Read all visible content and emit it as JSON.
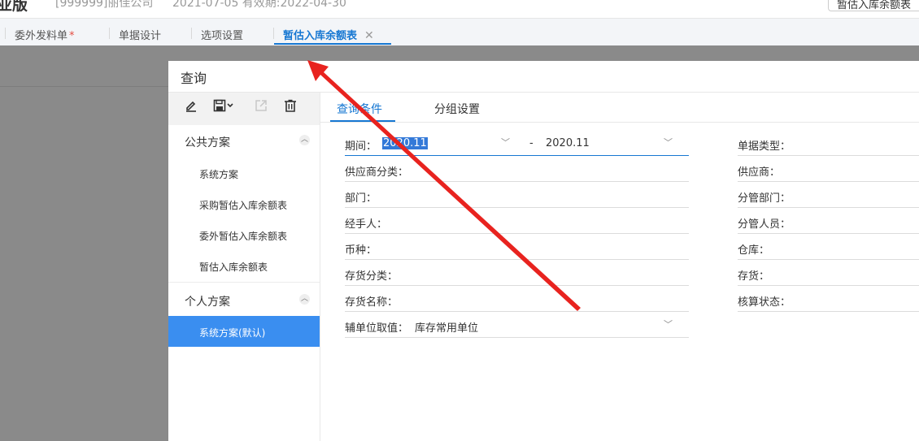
{
  "header": {
    "app_name": "业版",
    "company": "[999999]丽佳公司",
    "dates": "2021-07-05   有效期:2022-04-30",
    "report_button": "暂估入库余额表"
  },
  "tabs": [
    {
      "label": "委外发料单",
      "dirty_mark": "*"
    },
    {
      "label": "单据设计"
    },
    {
      "label": "选项设置"
    },
    {
      "label": "暂估入库余额表",
      "close": "✕"
    }
  ],
  "dialog": {
    "title": "查询",
    "toolbar_icons": [
      "edit-icon",
      "save-icon",
      "export-icon",
      "delete-icon"
    ],
    "public_group": {
      "label": "公共方案",
      "items": [
        "系统方案",
        "采购暂估入库余额表",
        "委外暂估入库余额表",
        "暂估入库余额表"
      ]
    },
    "personal_group": {
      "label": "个人方案",
      "items": [
        "系统方案(默认)"
      ]
    },
    "right_tabs": [
      "查询条件",
      "分组设置"
    ],
    "fields_left": {
      "period": {
        "label": "期间：",
        "from": "2020.11",
        "dash": "-",
        "to": "2020.11"
      },
      "supplier_category": "供应商分类：",
      "department": "部门：",
      "handler": "经手人：",
      "currency": "币种：",
      "inventory_category": "存货分类：",
      "inventory_name": "存货名称：",
      "aux_unit": {
        "label": "辅单位取值：",
        "value": "库存常用单位"
      }
    },
    "fields_right": {
      "doc_type": "单据类型：",
      "supplier": "供应商：",
      "managing_dept": "分管部门：",
      "managing_person": "分管人员：",
      "warehouse": "仓库：",
      "inventory": "存货：",
      "accounting_status": "核算状态："
    }
  },
  "colors": {
    "accent": "#1677d2",
    "selected_item": "#3a8ef0",
    "overlay": "#8a8a8a",
    "annotation_arrow": "#e8231f"
  }
}
